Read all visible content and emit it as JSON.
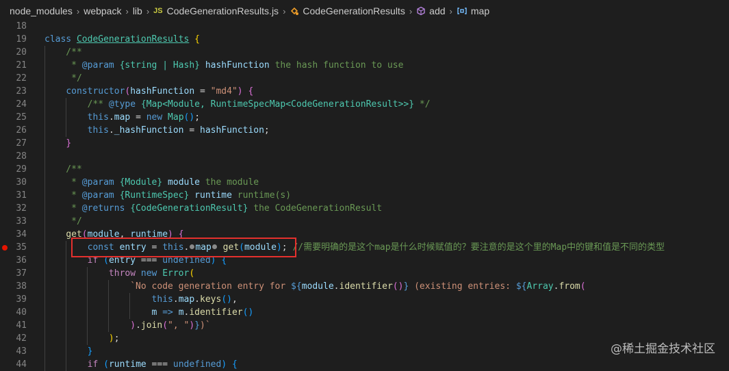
{
  "breadcrumb": {
    "items": [
      "node_modules",
      "webpack",
      "lib",
      "CodeGenerationResults.js",
      "CodeGenerationResults",
      "add",
      "map"
    ],
    "js_badge": "JS"
  },
  "code": {
    "lines": [
      {
        "n": "18"
      },
      {
        "n": "19"
      },
      {
        "n": "20"
      },
      {
        "n": "21"
      },
      {
        "n": "22"
      },
      {
        "n": "23"
      },
      {
        "n": "24"
      },
      {
        "n": "25"
      },
      {
        "n": "26"
      },
      {
        "n": "27"
      },
      {
        "n": "28"
      },
      {
        "n": "29"
      },
      {
        "n": "30"
      },
      {
        "n": "31"
      },
      {
        "n": "32"
      },
      {
        "n": "33"
      },
      {
        "n": "34"
      },
      {
        "n": "35"
      },
      {
        "n": "36"
      },
      {
        "n": "37"
      },
      {
        "n": "38"
      },
      {
        "n": "39"
      },
      {
        "n": "40"
      },
      {
        "n": "41"
      },
      {
        "n": "42"
      },
      {
        "n": "43"
      },
      {
        "n": "44"
      }
    ],
    "comment_35": "//需要明确的是这个map是什么时候赋值的？要注意的是这个里的Map中的键和值是不同的类型"
  },
  "watermark": "@稀土掘金技术社区",
  "colors": {
    "breakpoint": "#e51400",
    "highlight_box": "#e5302d",
    "background": "#1e1e1e"
  }
}
